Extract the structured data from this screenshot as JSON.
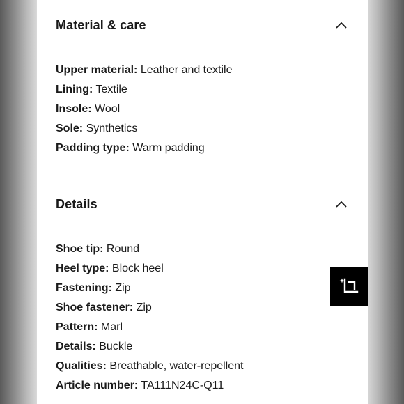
{
  "material_care": {
    "title": "Material & care",
    "toggle_icon": "chevron-up-icon",
    "rows": [
      {
        "label": "Upper material:",
        "value": "Leather and textile"
      },
      {
        "label": "Lining:",
        "value": "Textile"
      },
      {
        "label": "Insole:",
        "value": "Wool"
      },
      {
        "label": "Sole:",
        "value": "Synthetics"
      },
      {
        "label": "Padding type:",
        "value": "Warm padding"
      }
    ]
  },
  "details": {
    "title": "Details",
    "toggle_icon": "chevron-up-icon",
    "rows": [
      {
        "label": "Shoe tip:",
        "value": "Round"
      },
      {
        "label": "Heel type:",
        "value": "Block heel"
      },
      {
        "label": "Fastening:",
        "value": "Zip"
      },
      {
        "label": "Shoe fastener:",
        "value": "Zip"
      },
      {
        "label": "Pattern:",
        "value": "Marl"
      },
      {
        "label": "Details:",
        "value": "Buckle"
      },
      {
        "label": "Qualities:",
        "value": "Breathable, water-repellent"
      },
      {
        "label": "Article number:",
        "value": "TA111N24C-Q11"
      }
    ]
  },
  "floating_button": {
    "icon": "crop-sparkle-icon",
    "background": "#000000",
    "icon_color": "#ffffff"
  }
}
